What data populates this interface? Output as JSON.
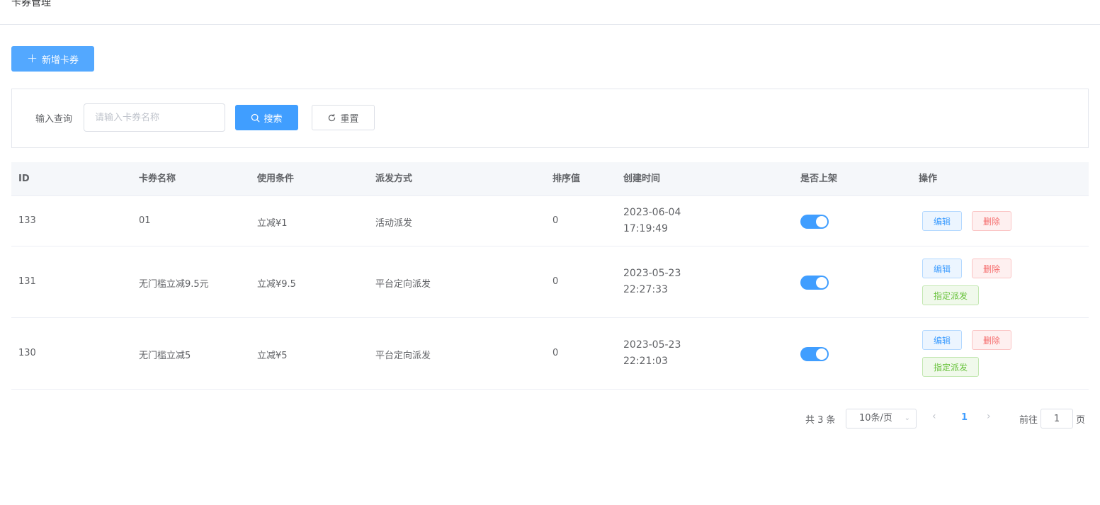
{
  "header": {
    "title": "卡券管理"
  },
  "toolbar": {
    "add_label": "新增卡券"
  },
  "search": {
    "label": "输入查询",
    "placeholder": "请输入卡券名称",
    "value": "",
    "search_label": "搜索",
    "reset_label": "重置"
  },
  "table": {
    "columns": {
      "id": "ID",
      "name": "卡券名称",
      "condition": "使用条件",
      "method": "派发方式",
      "sort": "排序值",
      "created": "创建时间",
      "listed": "是否上架",
      "ops": "操作"
    },
    "rows": [
      {
        "id": "133",
        "name": "01",
        "condition": "立减¥1",
        "method": "活动派发",
        "sort": "0",
        "date": "2023-06-04",
        "time": "17:19:49",
        "listed": true
      },
      {
        "id": "131",
        "name": "无门槛立减9.5元",
        "condition": "立减¥9.5",
        "method": "平台定向派发",
        "sort": "0",
        "date": "2023-05-23",
        "time": "22:27:33",
        "listed": true
      },
      {
        "id": "130",
        "name": "无门槛立减5",
        "condition": "立减¥5",
        "method": "平台定向派发",
        "sort": "0",
        "date": "2023-05-23",
        "time": "22:21:03",
        "listed": true
      }
    ],
    "actions": {
      "edit": "编辑",
      "delete": "删除",
      "assign": "指定派发"
    }
  },
  "pagination": {
    "total": "共 3 条",
    "page_size": "10条/页",
    "current": "1",
    "goto_label": "前往",
    "goto_value": "1",
    "page_suffix": "页"
  },
  "colors": {
    "primary": "#409eff",
    "danger": "#f56c6c",
    "success": "#67c23a"
  }
}
